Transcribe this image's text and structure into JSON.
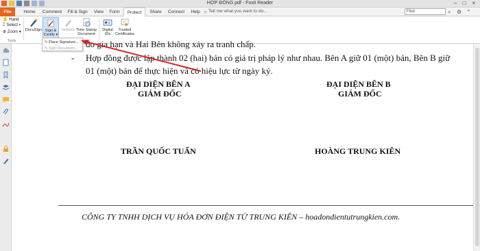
{
  "window": {
    "title": "HỢP ĐỒNG.pdf - Foxit Reader"
  },
  "tabs": [
    {
      "label": "File"
    },
    {
      "label": "Home"
    },
    {
      "label": "Comment"
    },
    {
      "label": "Fill & Sign"
    },
    {
      "label": "View"
    },
    {
      "label": "Form"
    },
    {
      "label": "Protect"
    },
    {
      "label": "Share"
    },
    {
      "label": "Connect"
    },
    {
      "label": "Help"
    }
  ],
  "tell_me": {
    "text": "Tell me what you want to do..."
  },
  "search": {
    "placeholder": "Find"
  },
  "tools_group": {
    "hand": "Hand",
    "select": "Select",
    "zoom": "Zoom",
    "label": "Tools"
  },
  "ribbon": {
    "docusign": "DocuSign",
    "sign_certify_1": "Sign &",
    "sign_certify_2": "Certify",
    "validate": "Validate",
    "timestamp_1": "Time Stamp",
    "timestamp_2": "Document",
    "digital_1": "Digital",
    "digital_2": "IDs",
    "trusted_1": "Trusted",
    "trusted_2": "Certificates"
  },
  "dropdown": {
    "place_signature": "Place Signature...",
    "sign_document": "Sign Document..."
  },
  "document": {
    "line0": "do gia hạn và Hai Bên không xảy ra tranh chấp.",
    "bullet": "-",
    "line1": "Hợp đồng được lập thành 02 (hai) bản có giá trị pháp lý như nhau. Bên A giữ 01 (một) bản, Bên B giữ",
    "line2": "01 (một) bản để thực hiện và có hiệu lực từ ngày ký.",
    "rep_a": "ĐẠI DIỆN BÊN A",
    "dir_a": "GIÁM ĐỐC",
    "rep_b": "ĐẠI DIỆN BÊN B",
    "dir_b": "GIÁM ĐỐC",
    "name_a": "TRẦN QUỐC TUẤN",
    "name_b": "HOÀNG TRUNG KIÊN",
    "footer": "CÔNG TY TNHH DỊCH VỤ HÓA ĐƠN ĐIỆN TỬ TRUNG KIÊN –  hoadondientutrungkien.com."
  },
  "colors": {
    "file_tab": "#e8631e",
    "arrow": "#d42020",
    "selected": "#cfe3f7"
  }
}
